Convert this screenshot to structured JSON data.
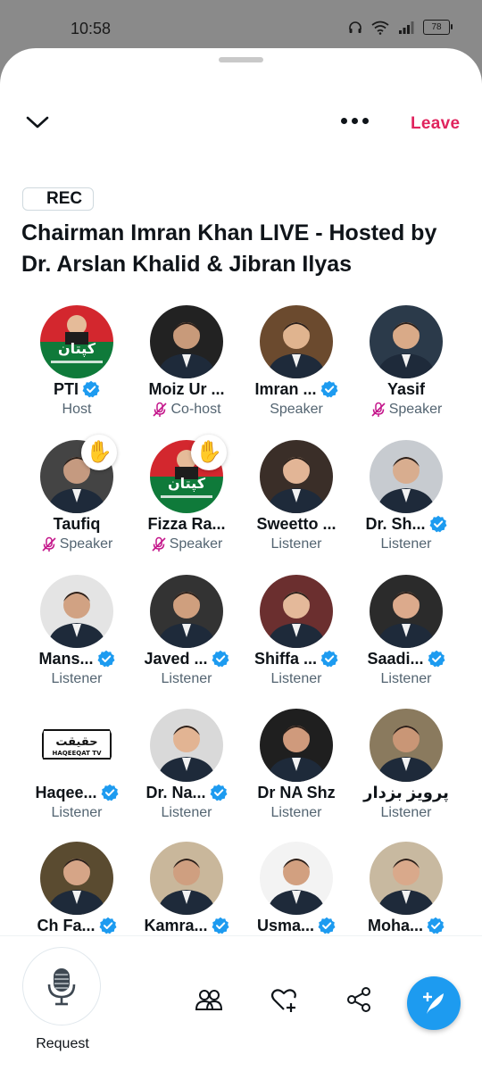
{
  "status_bar": {
    "time": "10:58",
    "battery": "78"
  },
  "header": {
    "leave_label": "Leave"
  },
  "space": {
    "rec_label": "REC",
    "title": "Chairman Imran Khan LIVE  - Hosted by Dr. Arslan Khalid & Jibran Ilyas"
  },
  "participants": [
    {
      "name": "PTI",
      "role": "Host",
      "verified": true,
      "muted": false,
      "hand": false,
      "avatar": "pti-logo"
    },
    {
      "name": "Moiz Ur ...",
      "role": "Co-host",
      "verified": false,
      "muted": true,
      "hand": false,
      "avatar": "photo"
    },
    {
      "name": "Imran ...",
      "role": "Speaker",
      "verified": true,
      "muted": false,
      "hand": false,
      "avatar": "photo"
    },
    {
      "name": "Yasif",
      "role": "Speaker",
      "verified": false,
      "muted": true,
      "hand": false,
      "avatar": "photo"
    },
    {
      "name": "Taufiq",
      "role": "Speaker",
      "verified": false,
      "muted": true,
      "hand": true,
      "avatar": "photo"
    },
    {
      "name": "Fizza Ra...",
      "role": "Speaker",
      "verified": false,
      "muted": true,
      "hand": true,
      "avatar": "pti-logo"
    },
    {
      "name": "Sweetto ...",
      "role": "Listener",
      "verified": false,
      "muted": false,
      "hand": false,
      "avatar": "photo"
    },
    {
      "name": "Dr. Sh...",
      "role": "Listener",
      "verified": true,
      "muted": false,
      "hand": false,
      "avatar": "photo"
    },
    {
      "name": "Mans...",
      "role": "Listener",
      "verified": true,
      "muted": false,
      "hand": false,
      "avatar": "photo"
    },
    {
      "name": "Javed ...",
      "role": "Listener",
      "verified": true,
      "muted": false,
      "hand": false,
      "avatar": "photo"
    },
    {
      "name": "Shiffa ...",
      "role": "Listener",
      "verified": true,
      "muted": false,
      "hand": false,
      "avatar": "photo"
    },
    {
      "name": "Saadi...",
      "role": "Listener",
      "verified": true,
      "muted": false,
      "hand": false,
      "avatar": "photo"
    },
    {
      "name": "Haqee...",
      "role": "Listener",
      "verified": true,
      "muted": false,
      "hand": false,
      "avatar": "haqeeqat-logo",
      "logo_text": "HAQEEQAT TV",
      "logo_urdu": "حقیقت"
    },
    {
      "name": "Dr. Na...",
      "role": "Listener",
      "verified": true,
      "muted": false,
      "hand": false,
      "avatar": "photo"
    },
    {
      "name": "Dr NA Shz",
      "role": "Listener",
      "verified": false,
      "muted": false,
      "hand": false,
      "avatar": "photo"
    },
    {
      "name": "پرویز بزدار",
      "role": "Listener",
      "verified": false,
      "muted": false,
      "hand": false,
      "avatar": "photo"
    },
    {
      "name": "Ch Fa...",
      "role": "",
      "verified": true,
      "muted": false,
      "hand": false,
      "avatar": "photo"
    },
    {
      "name": "Kamra...",
      "role": "",
      "verified": true,
      "muted": false,
      "hand": false,
      "avatar": "photo"
    },
    {
      "name": "Usma...",
      "role": "",
      "verified": true,
      "muted": false,
      "hand": false,
      "avatar": "photo"
    },
    {
      "name": "Moha...",
      "role": "",
      "verified": true,
      "muted": false,
      "hand": false,
      "avatar": "photo"
    }
  ],
  "bottom": {
    "request_label": "Request"
  },
  "colors": {
    "accent": "#1d9bf0",
    "leave": "#e0245e",
    "muted_icon": "#c4158a"
  }
}
